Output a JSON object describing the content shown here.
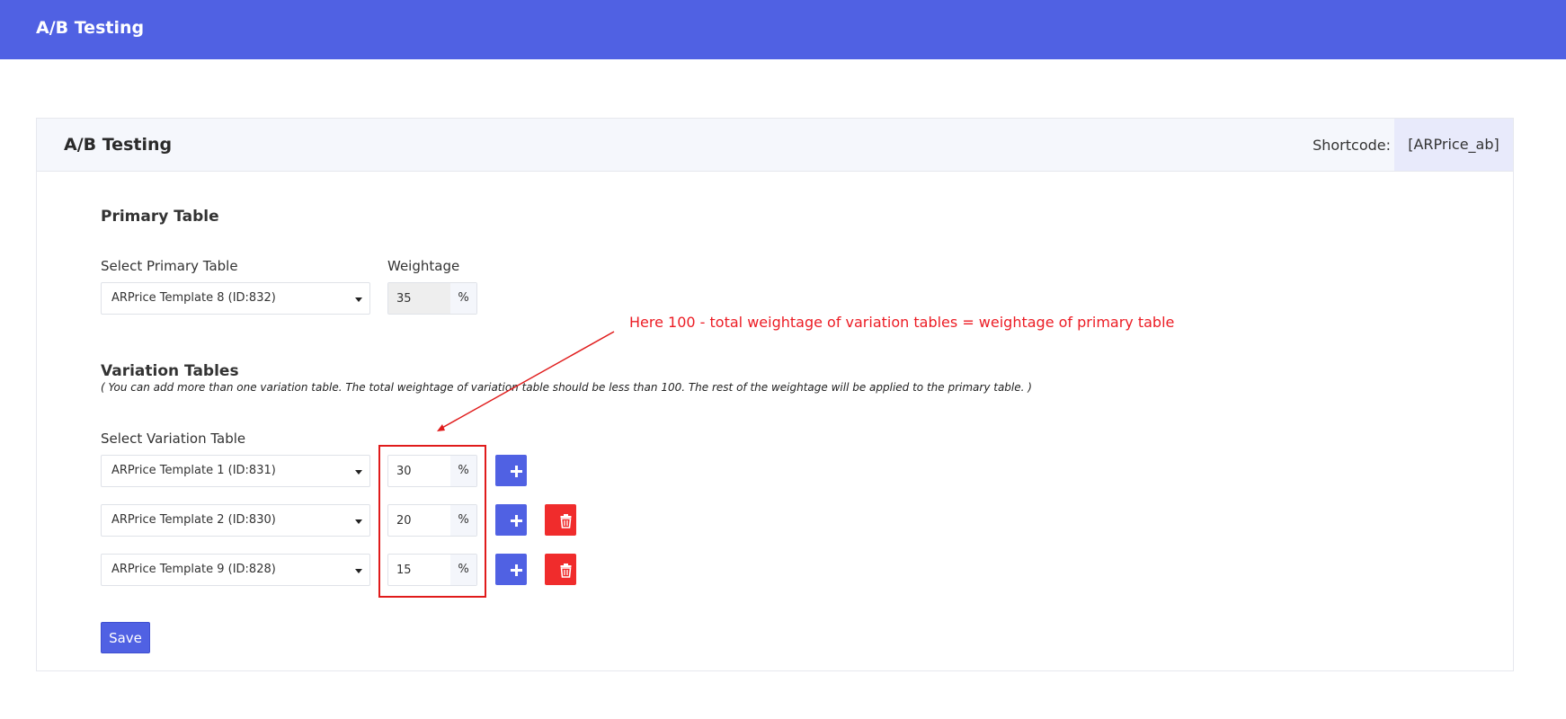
{
  "app": {
    "title": "A/B Testing"
  },
  "card": {
    "title": "A/B Testing",
    "shortcode_label": "Shortcode:",
    "shortcode_value": "[ARPrice_ab]"
  },
  "primary": {
    "heading": "Primary Table",
    "select_label": "Select Primary Table",
    "weight_label": "Weightage",
    "selected_table": "ARPrice Template 8 (ID:832)",
    "weight": "35",
    "unit": "%"
  },
  "variation": {
    "heading": "Variation Tables",
    "hint": "( You can add more than one variation table. The total weightage of variation table should be less than 100. The rest of the weightage will be applied to the primary table. )",
    "select_label": "Select Variation Table",
    "rows": [
      {
        "table": "ARPrice Template 1 (ID:831)",
        "weight": "30",
        "unit": "%",
        "has_delete": false
      },
      {
        "table": "ARPrice Template 2 (ID:830)",
        "weight": "20",
        "unit": "%",
        "has_delete": true
      },
      {
        "table": "ARPrice Template 9 (ID:828)",
        "weight": "15",
        "unit": "%",
        "has_delete": true
      }
    ]
  },
  "actions": {
    "save_label": "Save"
  },
  "annotation": {
    "text": "Here 100 - total weightage of variation tables = weightage of primary table",
    "color": "#ec1c24"
  },
  "icons": {
    "add": "plus-icon",
    "delete": "trash-icon"
  },
  "colors": {
    "brand": "#5061e3",
    "danger": "#f02c2c"
  }
}
